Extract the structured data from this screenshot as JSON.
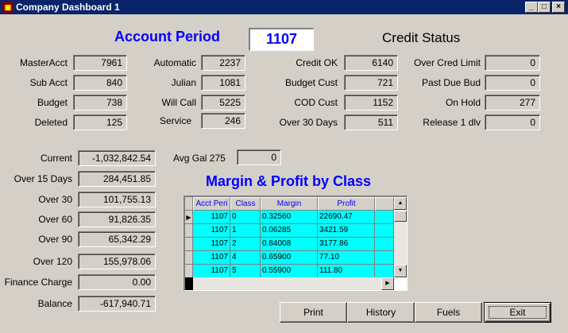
{
  "window": {
    "title": "Company Dashboard 1",
    "app_icon": "app-icon",
    "minimize": "_",
    "maximize": "□",
    "close": "×"
  },
  "account_period": {
    "label": "Account Period",
    "value": "1107"
  },
  "credit_status": {
    "label": "Credit Status"
  },
  "accounts": {
    "master_acct": {
      "label": "MasterAcct",
      "value": "7961"
    },
    "sub_acct": {
      "label": "Sub Acct",
      "value": "840"
    },
    "budget": {
      "label": "Budget",
      "value": "738"
    },
    "deleted": {
      "label": "Deleted",
      "value": "125"
    },
    "automatic": {
      "label": "Automatic",
      "value": "2237"
    },
    "julian": {
      "label": "Julian",
      "value": "1081"
    },
    "will_call": {
      "label": "Will Call",
      "value": "5225"
    },
    "service": {
      "label": "Service",
      "value": "246"
    }
  },
  "credit": {
    "credit_ok": {
      "label": "Credit OK",
      "value": "6140"
    },
    "budget_cust": {
      "label": "Budget Cust",
      "value": "721"
    },
    "cod_cust": {
      "label": "COD Cust",
      "value": "1152"
    },
    "over_30_days": {
      "label": "Over 30 Days",
      "value": "511"
    },
    "over_cred_limit": {
      "label": "Over Cred Limit",
      "value": "0"
    },
    "past_due_bud": {
      "label": "Past Due Bud",
      "value": "0"
    },
    "on_hold": {
      "label": "On Hold",
      "value": "277"
    },
    "release_1_dlv": {
      "label": "Release 1 dlv",
      "value": "0"
    }
  },
  "aging": {
    "current": {
      "label": "Current",
      "value": "-1,032,842.54"
    },
    "over_15_days": {
      "label": "Over 15 Days",
      "value": "284,451.85"
    },
    "over_30": {
      "label": "Over 30",
      "value": "101,755.13"
    },
    "over_60": {
      "label": "Over 60",
      "value": "91,826.35"
    },
    "over_90": {
      "label": "Over 90",
      "value": "65,342.29"
    },
    "over_120": {
      "label": "Over 120",
      "value": "155,978.06"
    },
    "finance_charge": {
      "label": "Finance Charge",
      "value": "0.00"
    },
    "balance": {
      "label": "Balance",
      "value": "-617,940.71"
    }
  },
  "avg_gal": {
    "label": "Avg Gal 275",
    "value": "0"
  },
  "margin_profit": {
    "title": "Margin & Profit by Class",
    "columns": [
      "Acct Peri",
      "Class",
      "Margin",
      "Profit"
    ],
    "rows": [
      {
        "acct_period": "1107",
        "class": "0",
        "margin": "0.32560",
        "profit": "22690.47"
      },
      {
        "acct_period": "1107",
        "class": "1",
        "margin": "0.06285",
        "profit": "3421.59"
      },
      {
        "acct_period": "1107",
        "class": "2",
        "margin": "0.84008",
        "profit": "3177.86"
      },
      {
        "acct_period": "1107",
        "class": "4",
        "margin": "0.65900",
        "profit": "77.10"
      },
      {
        "acct_period": "1107",
        "class": "5",
        "margin": "0.55900",
        "profit": "111.80"
      }
    ]
  },
  "buttons": {
    "print": "Print",
    "history": "History",
    "fuels": "Fuels",
    "exit": "Exit"
  },
  "colors": {
    "accent_blue": "#0000ff",
    "grid_row": "#00ffff",
    "title_bar": "#0a246a",
    "window_bg": "#d4d0c8"
  }
}
